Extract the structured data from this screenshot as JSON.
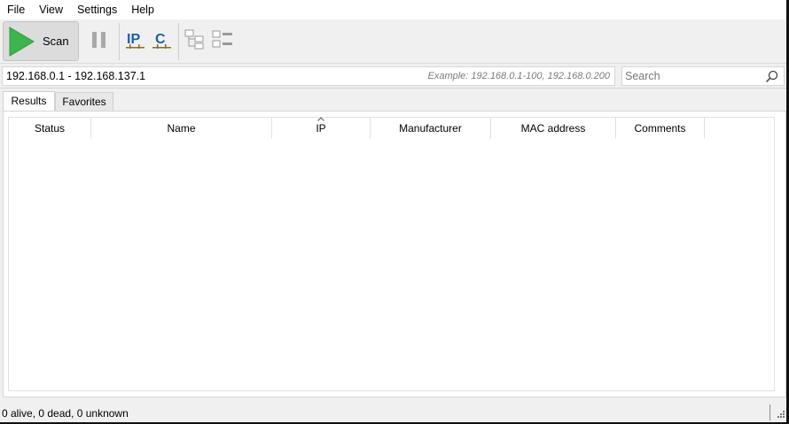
{
  "menu": [
    "File",
    "View",
    "Settings",
    "Help"
  ],
  "toolbar": {
    "scan_label": "Scan",
    "buttons": [
      "play-icon",
      "pause-icon",
      "ip-subnet-icon",
      "class-c-subnet-icon",
      "expand-all-icon",
      "collapse-all-icon"
    ]
  },
  "address": {
    "ip_range": "192.168.0.1 - 192.168.137.1",
    "example": "Example: 192.168.0.1-100, 192.168.0.200",
    "search_placeholder": "Search"
  },
  "tabs": [
    "Results",
    "Favorites"
  ],
  "results_table": {
    "columns": [
      "Status",
      "Name",
      "IP",
      "Manufacturer",
      "MAC address",
      "Comments"
    ],
    "sorted_column": "IP",
    "rows": []
  },
  "status": {
    "text": "0 alive, 0 dead, 0 unknown"
  },
  "colors": {
    "scan_play": "#3cb54a",
    "accent_blue": "#1a5fb4",
    "pause_gray": "#a9a9a9"
  }
}
